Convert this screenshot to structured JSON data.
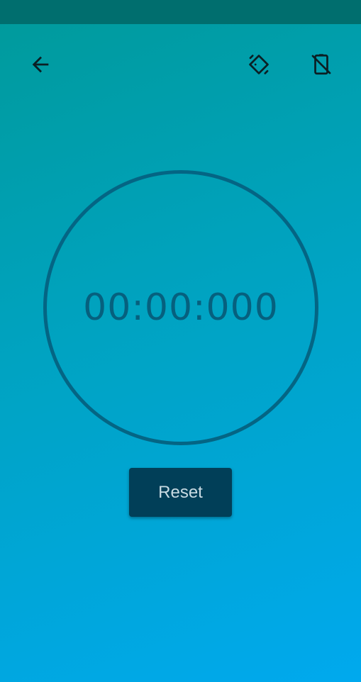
{
  "theme": {
    "status_bar_color": "#006e6e",
    "gradient_start": "#009a9a",
    "gradient_end": "#00a9ee",
    "dial_color": "#046584",
    "button_color": "#013f58",
    "button_text_color": "#c9dbe3",
    "icon_color": "#0b1f24"
  },
  "toolbar": {
    "back_icon": "arrow-left-icon",
    "rotate_icon": "screen-rotation-icon",
    "screen_off_icon": "screen-lock-off-icon"
  },
  "stopwatch": {
    "time": "00:00:000"
  },
  "controls": {
    "reset_label": "Reset"
  }
}
